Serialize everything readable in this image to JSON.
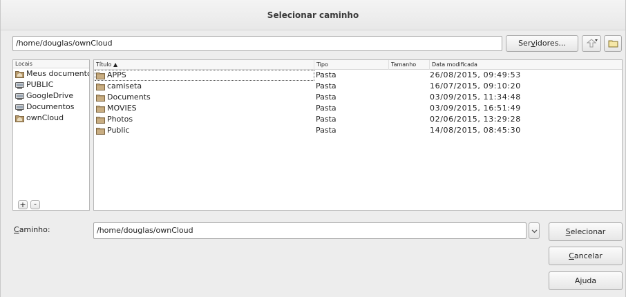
{
  "window": {
    "title": "Selecionar caminho"
  },
  "toolbar": {
    "current_path": "/home/douglas/ownCloud",
    "servers_prefix": "Ser",
    "servers_mnemonic": "v",
    "servers_suffix": "idores...",
    "up_icon": "up-folder-icon",
    "new_folder_icon": "new-folder-icon"
  },
  "places": {
    "header": "Locais",
    "items": [
      {
        "label": "Meus documentos",
        "icon": "home-folder-icon"
      },
      {
        "label": "PUBLIC",
        "icon": "drive-icon"
      },
      {
        "label": "GoogleDrive",
        "icon": "drive-icon"
      },
      {
        "label": "Documentos",
        "icon": "drive-icon"
      },
      {
        "label": "ownCloud",
        "icon": "home-folder-icon"
      }
    ],
    "add_label": "+",
    "remove_label": "-"
  },
  "files": {
    "columns": {
      "name": "Título ▲",
      "type": "Tipo",
      "size": "Tamanho",
      "date": "Data modificada"
    },
    "rows": [
      {
        "name": "APPS",
        "type": "Pasta",
        "size": "",
        "date": "26/08/2015, 09:49:53"
      },
      {
        "name": "camiseta",
        "type": "Pasta",
        "size": "",
        "date": "16/07/2015, 09:10:20"
      },
      {
        "name": "Documents",
        "type": "Pasta",
        "size": "",
        "date": "03/09/2015, 11:34:48"
      },
      {
        "name": "MOVIES",
        "type": "Pasta",
        "size": "",
        "date": "03/09/2015, 16:51:49"
      },
      {
        "name": "Photos",
        "type": "Pasta",
        "size": "",
        "date": "02/06/2015, 13:29:28"
      },
      {
        "name": "Public",
        "type": "Pasta",
        "size": "",
        "date": "14/08/2015, 08:45:30"
      }
    ]
  },
  "footer": {
    "path_label_mnemonic": "C",
    "path_label_rest": "aminho:",
    "path_value": "/home/douglas/ownCloud",
    "select_mnemonic": "S",
    "select_rest": "elecionar",
    "cancel_mnemonic": "C",
    "cancel_rest": "ancelar",
    "help_prefix": "A",
    "help_mnemonic": "j",
    "help_suffix": "uda"
  },
  "colors": {
    "folder": "#b79a6c",
    "selection_outline": "#555555",
    "background": "#ededed"
  }
}
